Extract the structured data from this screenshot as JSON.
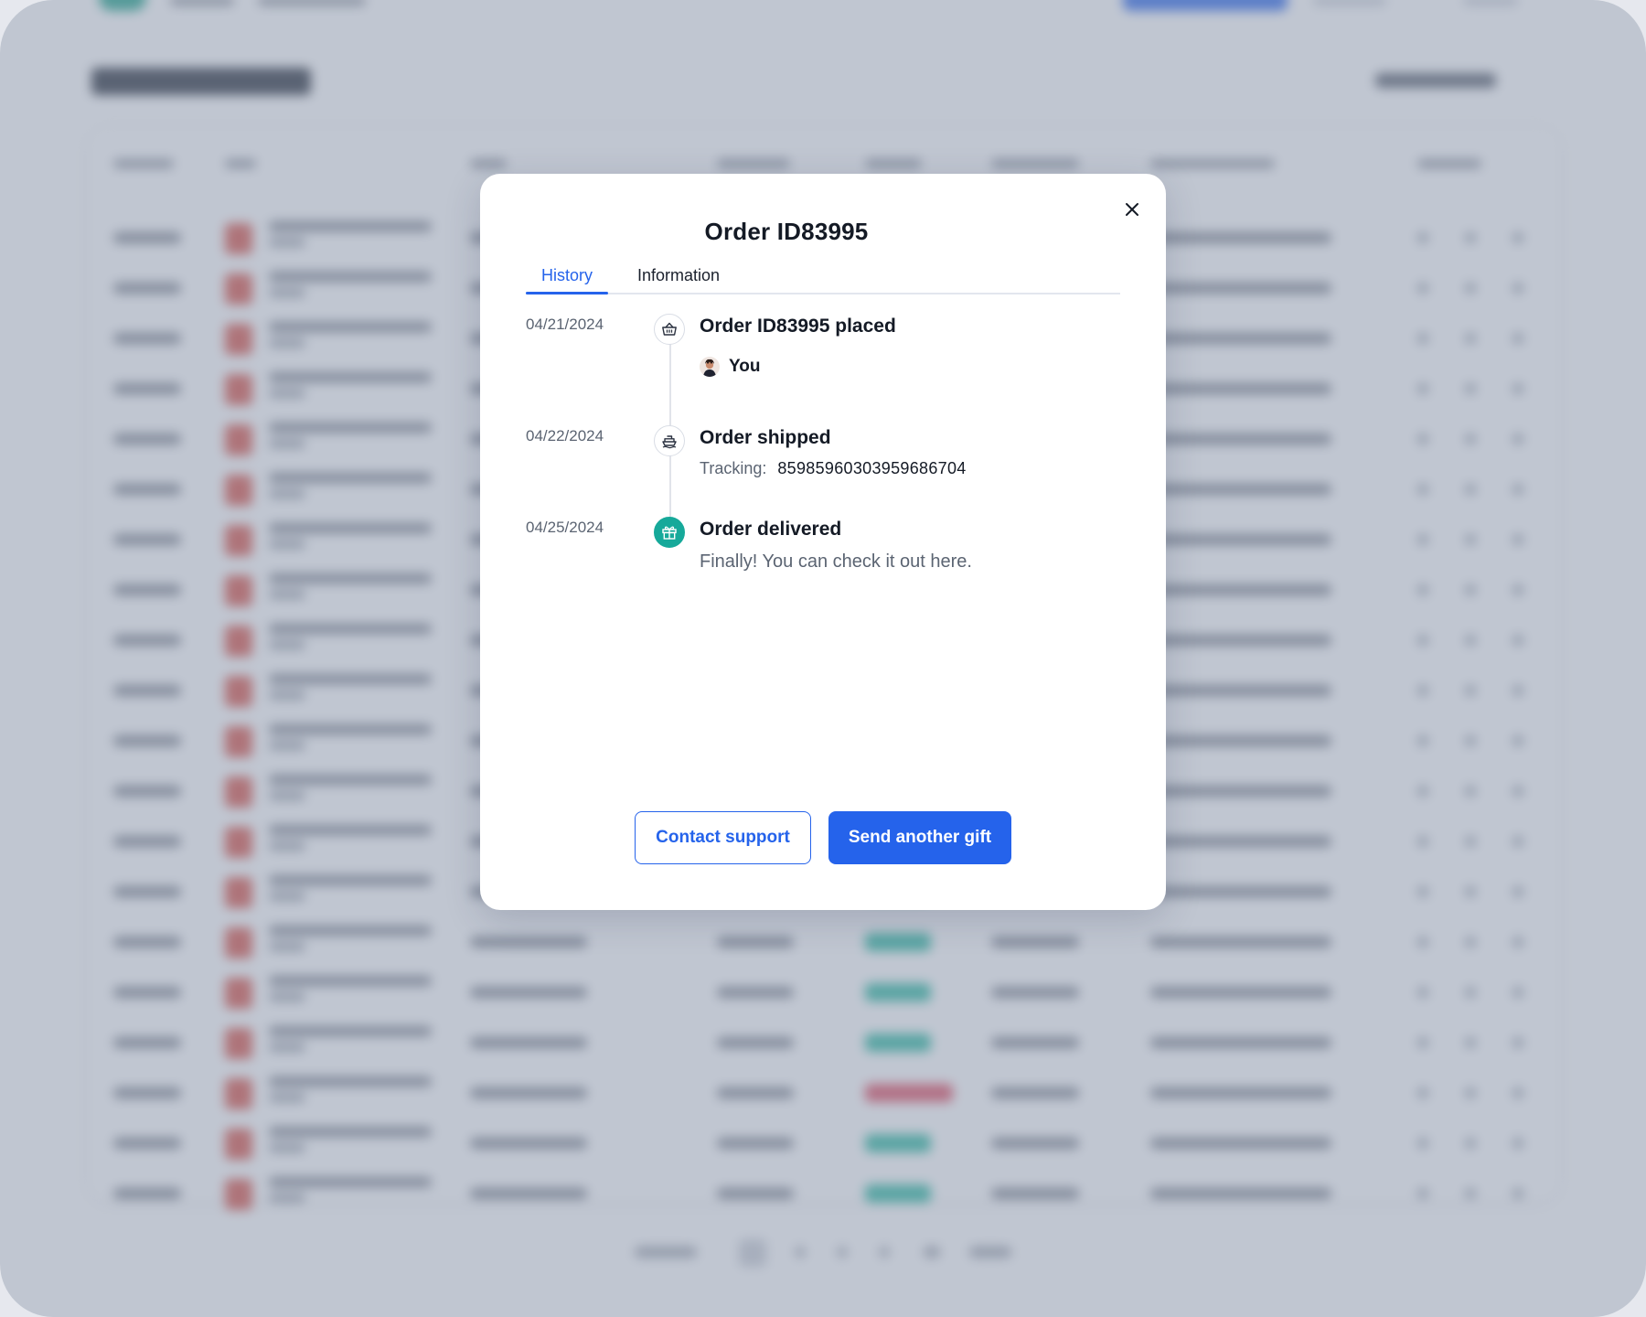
{
  "modal": {
    "title": "Order ID83995",
    "tabs": [
      {
        "label": "History",
        "active": true
      },
      {
        "label": "Information",
        "active": false
      }
    ],
    "history": [
      {
        "date": "04/21/2024",
        "title": "Order ID83995 placed",
        "icon": "basket-icon",
        "actor": "You"
      },
      {
        "date": "04/22/2024",
        "title": "Order shipped",
        "icon": "ship-icon",
        "tracking_label": "Tracking:",
        "tracking_number": "85985960303959686704"
      },
      {
        "date": "04/25/2024",
        "title": "Order delivered",
        "icon": "gift-icon",
        "message": "Finally! You can check it out here."
      }
    ],
    "actions": {
      "contact_support": "Contact support",
      "send_another_gift": "Send another gift"
    }
  },
  "colors": {
    "accent": "#2563eb",
    "delivered": "#16a99a",
    "overlay": "#8d97ac"
  }
}
